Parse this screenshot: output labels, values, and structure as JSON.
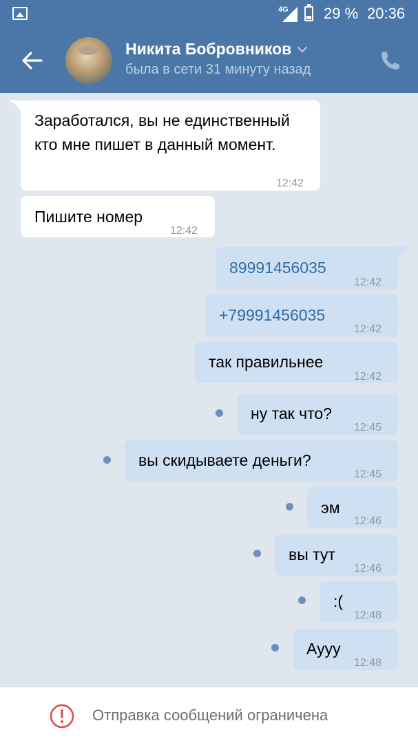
{
  "status_bar": {
    "network": "4G",
    "battery_percent": "29 %",
    "time": "20:36",
    "icons": [
      "gallery-icon",
      "signal-icon",
      "battery-icon"
    ]
  },
  "header": {
    "contact_name": "Никита Бобровников",
    "last_seen": "была в сети 31 минуту назад",
    "icons": [
      "back-arrow-icon",
      "chevron-down-icon",
      "phone-icon"
    ]
  },
  "messages": [
    {
      "direction": "in",
      "text": "Заработался, вы не единственный кто мне пишет в данный момент.",
      "time": "12:42"
    },
    {
      "direction": "in",
      "text": "Пишите номер",
      "time": "12:42"
    },
    {
      "direction": "out",
      "text": "89991456035",
      "time": "12:42"
    },
    {
      "direction": "out",
      "text": "+79991456035",
      "time": "12:42"
    },
    {
      "direction": "out",
      "text": "так правильнее",
      "time": "12:42"
    },
    {
      "direction": "out",
      "text": "ну так что?",
      "time": "12:45",
      "unread": true
    },
    {
      "direction": "out",
      "text": "вы скидываете деньги?",
      "time": "12:45",
      "unread": true
    },
    {
      "direction": "out",
      "text": "эм",
      "time": "12:46",
      "unread": true
    },
    {
      "direction": "out",
      "text": "вы тут",
      "time": "12:46",
      "unread": true
    },
    {
      "direction": "out",
      "text": ":(",
      "time": "12:48",
      "unread": true
    },
    {
      "direction": "out",
      "text": "Аууу",
      "time": "12:48",
      "unread": true
    }
  ],
  "footer": {
    "notice": "Отправка сообщений ограничена",
    "icon": "warning-icon"
  },
  "colors": {
    "header": "#4a76a8",
    "background": "#dfe6ee",
    "incoming": "#ffffff",
    "outgoing": "#cfe0f2",
    "unread_dot": "#6c8fbf",
    "warning": "#e64646"
  }
}
